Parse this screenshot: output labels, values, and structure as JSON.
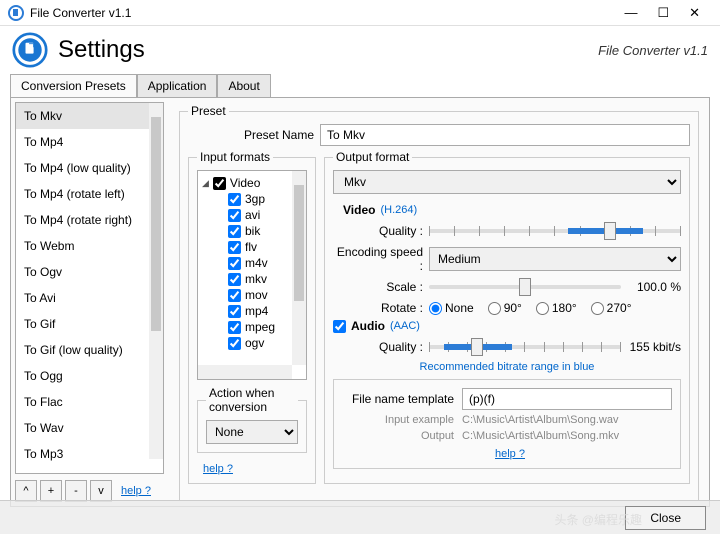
{
  "window": {
    "title": "File Converter v1.1",
    "subtitle": "File Converter v1.1"
  },
  "header": {
    "title": "Settings"
  },
  "tabs": {
    "t0": "Conversion Presets",
    "t1": "Application",
    "t2": "About"
  },
  "presets": {
    "items": [
      "To Mkv",
      "To Mp4",
      "To Mp4 (low quality)",
      "To Mp4 (rotate left)",
      "To Mp4 (rotate right)",
      "To Webm",
      "To Ogv",
      "To Avi",
      "To Gif",
      "To Gif (low quality)",
      "To Ogg",
      "To Flac",
      "To Wav",
      "To Mp3"
    ],
    "btn_up": "^",
    "btn_add": "+",
    "btn_del": "-",
    "btn_down": "v",
    "help": "help ?"
  },
  "preset": {
    "legend": "Preset",
    "name_label": "Preset Name",
    "name_value": "To Mkv",
    "input_formats_legend": "Input formats",
    "tree_root": "Video",
    "tree_items": [
      "3gp",
      "avi",
      "bik",
      "flv",
      "m4v",
      "mkv",
      "mov",
      "mp4",
      "mpeg",
      "ogv"
    ],
    "action_legend": "Action when conversion",
    "action_value": "None",
    "help": "help ?"
  },
  "output": {
    "legend": "Output format",
    "format": "Mkv",
    "video_label": "Video",
    "video_codec": "(H.264)",
    "quality_label": "Quality :",
    "encspeed_label": "Encoding speed :",
    "encspeed_value": "Medium",
    "scale_label": "Scale :",
    "scale_value": "100.0 %",
    "rotate_label": "Rotate :",
    "rotate_opts": {
      "none": "None",
      "r90": "90°",
      "r180": "180°",
      "r270": "270°"
    },
    "audio_label": "Audio",
    "audio_codec": "(AAC)",
    "audio_quality_label": "Quality :",
    "audio_quality_value": "155 kbit/s",
    "reco": "Recommended bitrate range in blue"
  },
  "fname": {
    "label": "File name template",
    "value": "(p)(f)",
    "in_label": "Input example",
    "in_value": "C:\\Music\\Artist\\Album\\Song.wav",
    "out_label": "Output",
    "out_value": "C:\\Music\\Artist\\Album\\Song.mkv",
    "help": "help ?"
  },
  "footer": {
    "close": "Close"
  },
  "watermark": "头条 @编程乐趣"
}
